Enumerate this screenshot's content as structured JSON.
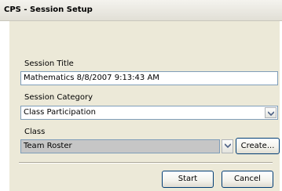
{
  "window": {
    "title": "CPS - Session Setup"
  },
  "form": {
    "session_title_label": "Session Title",
    "session_title_value": "Mathematics 8/8/2007 9:13:43 AM",
    "session_category_label": "Session Category",
    "session_category_value": "Class Participation",
    "class_label": "Class",
    "class_value": "Team Roster",
    "create_button": "Create..."
  },
  "buttons": {
    "start": "Start",
    "cancel": "Cancel"
  },
  "icons": {
    "dropdown": "chevron-down-icon"
  }
}
